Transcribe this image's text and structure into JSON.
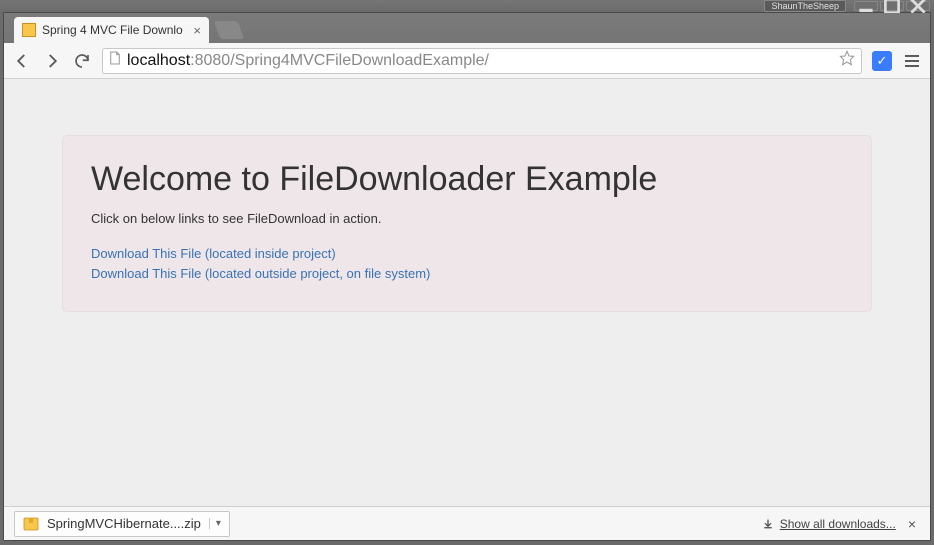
{
  "window": {
    "user_badge": "ShaunTheSheep"
  },
  "tab": {
    "title": "Spring 4 MVC File Downlo"
  },
  "url": {
    "host": "localhost",
    "port": ":8080",
    "path": "/Spring4MVCFileDownloadExample/"
  },
  "page": {
    "heading": "Welcome to FileDownloader Example",
    "subtext": "Click on below links to see FileDownload in action.",
    "link1": "Download This File (located inside project)",
    "link2": "Download This File (located outside project, on file system)"
  },
  "download_bar": {
    "file_name": "SpringMVCHibernate....zip",
    "show_all_label": "Show all downloads..."
  }
}
